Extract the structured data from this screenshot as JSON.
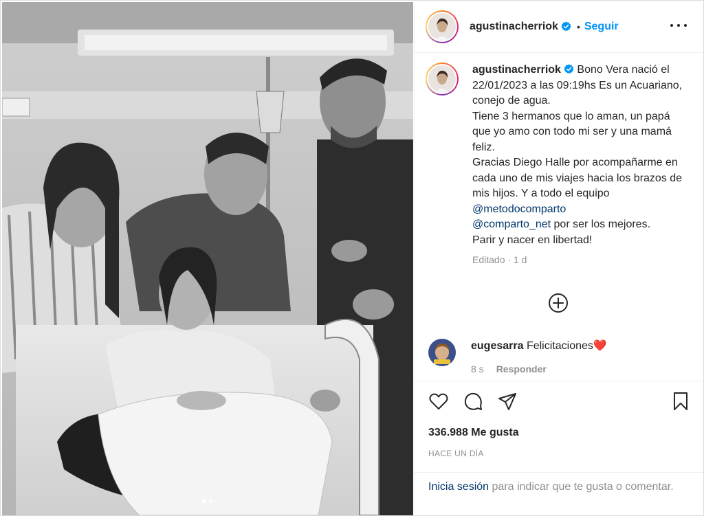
{
  "post": {
    "image_alt": "Hospital room photo: four adults around a new mother holding a newborn in bed (black and white)",
    "carousel_active": 1,
    "carousel_count": 2
  },
  "header": {
    "username": "agustinacherriok",
    "separator": "•",
    "follow_label": "Seguir",
    "verified_icon": "verified-badge-icon",
    "more_icon": "more-options-icon"
  },
  "caption": {
    "username": "agustinacherriok",
    "line1": "Bono Vera nació el 22/01/2023 a las 09:19hs Es un Acuariano, conejo de agua.",
    "line2": "Tiene 3 hermanos que lo aman, un papá que yo amo con todo mi ser y una mamá feliz.",
    "line3_before": "Gracias Diego Halle por acompañarme en cada uno de mis viajes hacia los brazos de mis hijos. Y a todo el equipo ",
    "mention1": "@metodocomparto",
    "mention2": "@comparto_net",
    "line3_after": " por ser los mejores.",
    "line4": "Parir y nacer en libertad!",
    "meta": "Editado · 1 d"
  },
  "add_comment_icon": "plus-circle-icon",
  "comment": {
    "username": "eugesarra",
    "text": "Felicitaciones",
    "emoji": "❤️",
    "time": "8 s",
    "reply_label": "Responder"
  },
  "actions": {
    "like_icon": "heart-icon",
    "comment_icon": "comment-bubble-icon",
    "share_icon": "paper-plane-icon",
    "save_icon": "bookmark-icon"
  },
  "likes_text": "336.988 Me gusta",
  "time_ago": "HACE UN DÍA",
  "login_prompt": {
    "link": "Inicia sesión",
    "text": " para indicar que te gusta o comentar."
  },
  "colors": {
    "link_blue": "#0095f6",
    "mention_dark_blue": "#00376b",
    "secondary_text": "#8e8e8e",
    "divider": "#efefef",
    "heart_red": "#ed4956"
  }
}
